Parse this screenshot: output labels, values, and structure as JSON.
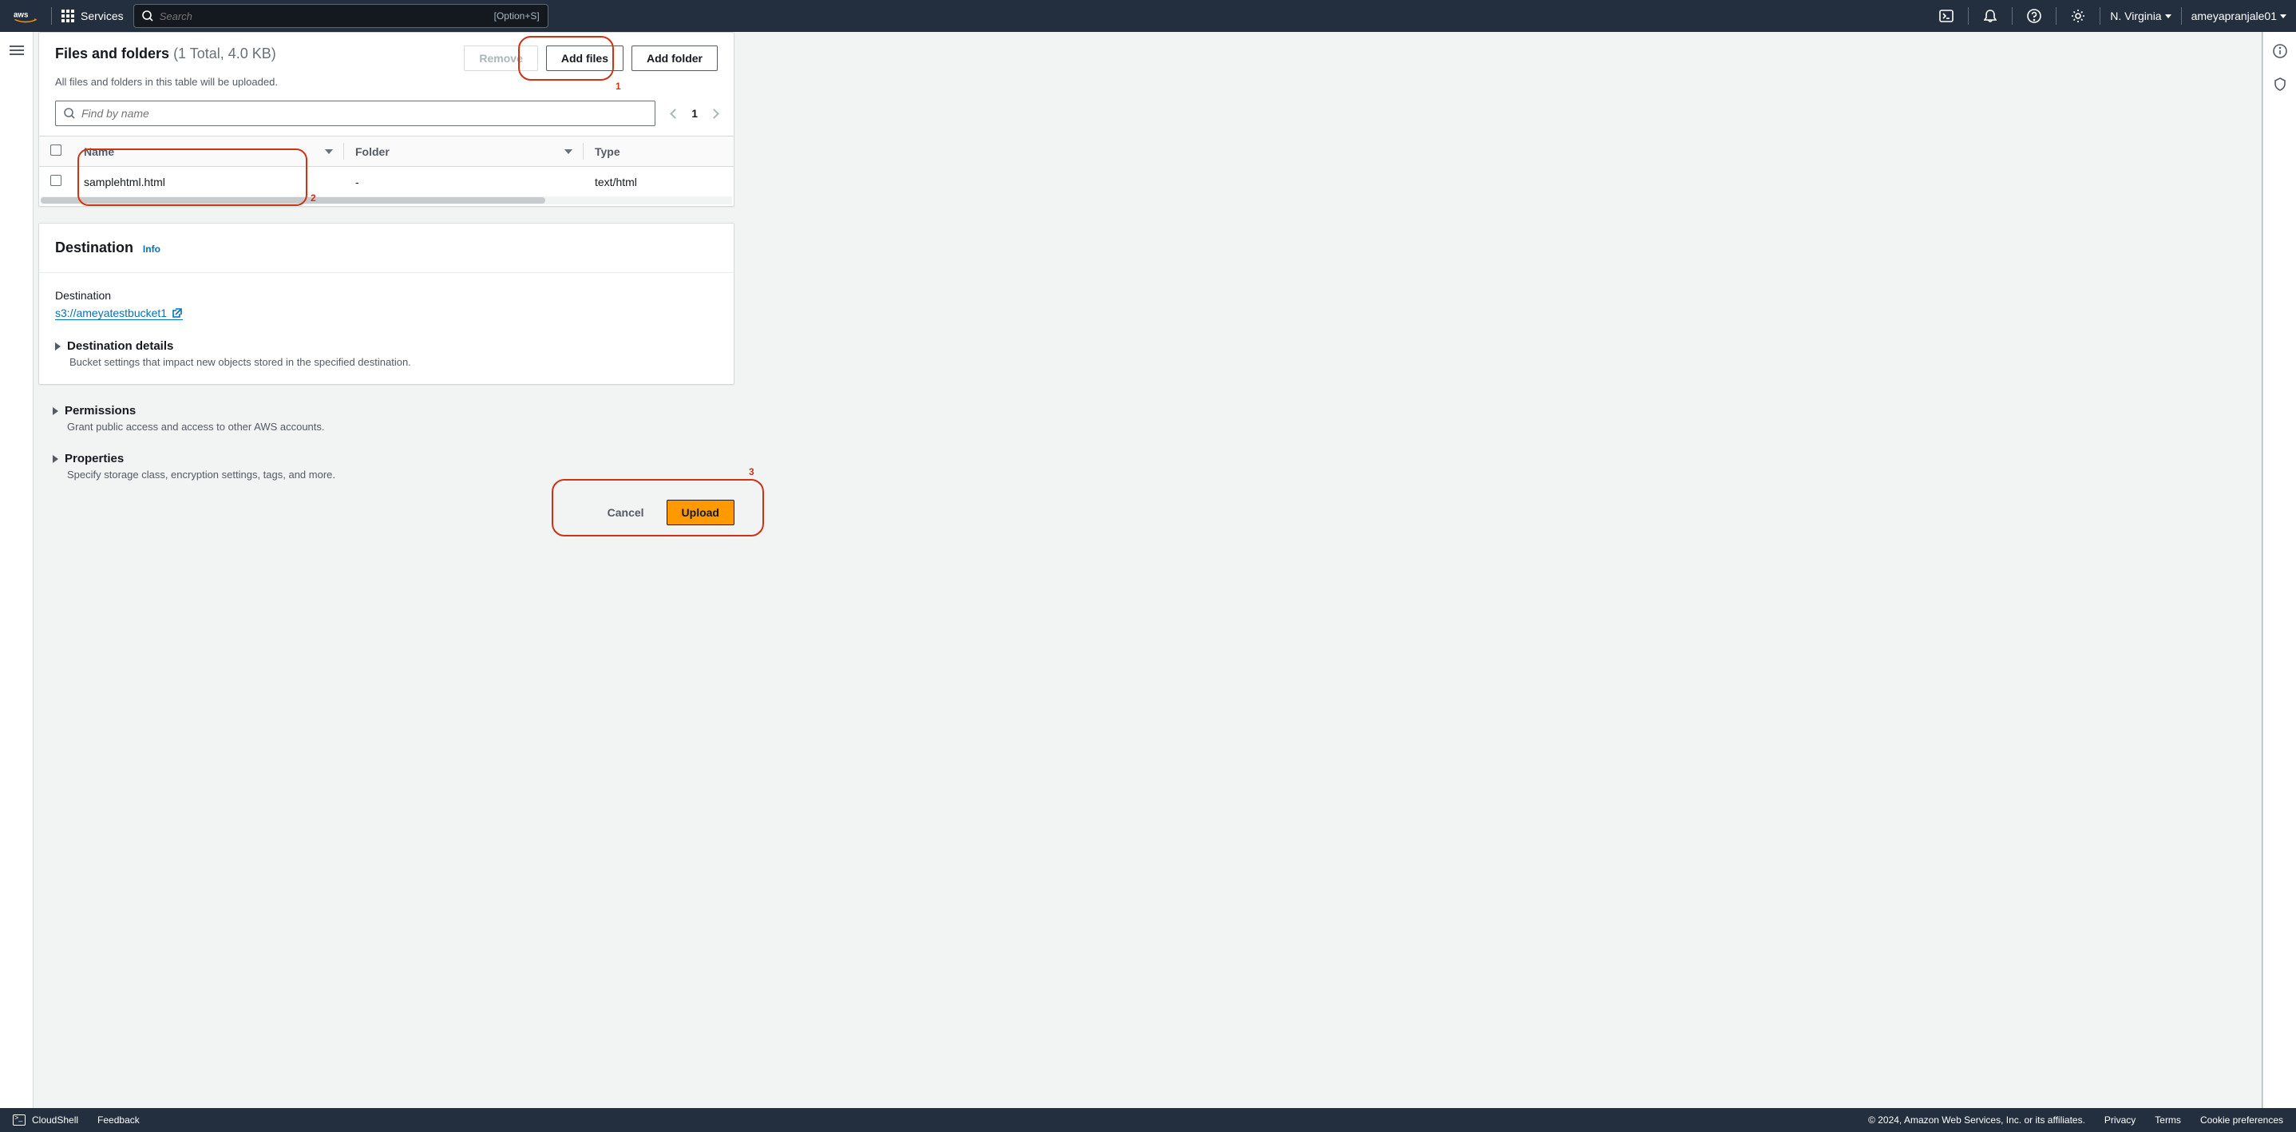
{
  "nav": {
    "services": "Services",
    "search_placeholder": "Search",
    "search_hint": "[Option+S]",
    "region": "N. Virginia",
    "account": "ameyapranjale01"
  },
  "files_card": {
    "title": "Files and folders",
    "counter": "(1 Total, 4.0 KB)",
    "desc": "All files and folders in this table will be uploaded.",
    "remove": "Remove",
    "add_files": "Add files",
    "add_folder": "Add folder",
    "find_placeholder": "Find by name",
    "page": "1",
    "cols": {
      "name": "Name",
      "folder": "Folder",
      "type": "Type"
    },
    "rows": [
      {
        "name": "samplehtml.html",
        "folder": "-",
        "type": "text/html"
      }
    ]
  },
  "dest_card": {
    "title": "Destination",
    "info": "Info",
    "label": "Destination",
    "link": "s3://ameyatestbucket1",
    "details_title": "Destination details",
    "details_desc": "Bucket settings that impact new objects stored in the specified destination."
  },
  "permissions": {
    "title": "Permissions",
    "desc": "Grant public access and access to other AWS accounts."
  },
  "properties": {
    "title": "Properties",
    "desc": "Specify storage class, encryption settings, tags, and more."
  },
  "actions": {
    "cancel": "Cancel",
    "upload": "Upload"
  },
  "footer": {
    "cloudshell": "CloudShell",
    "feedback": "Feedback",
    "copyright": "© 2024, Amazon Web Services, Inc. or its affiliates.",
    "privacy": "Privacy",
    "terms": "Terms",
    "cookies": "Cookie preferences"
  },
  "callouts": {
    "c1": "1",
    "c2": "2",
    "c3": "3"
  }
}
